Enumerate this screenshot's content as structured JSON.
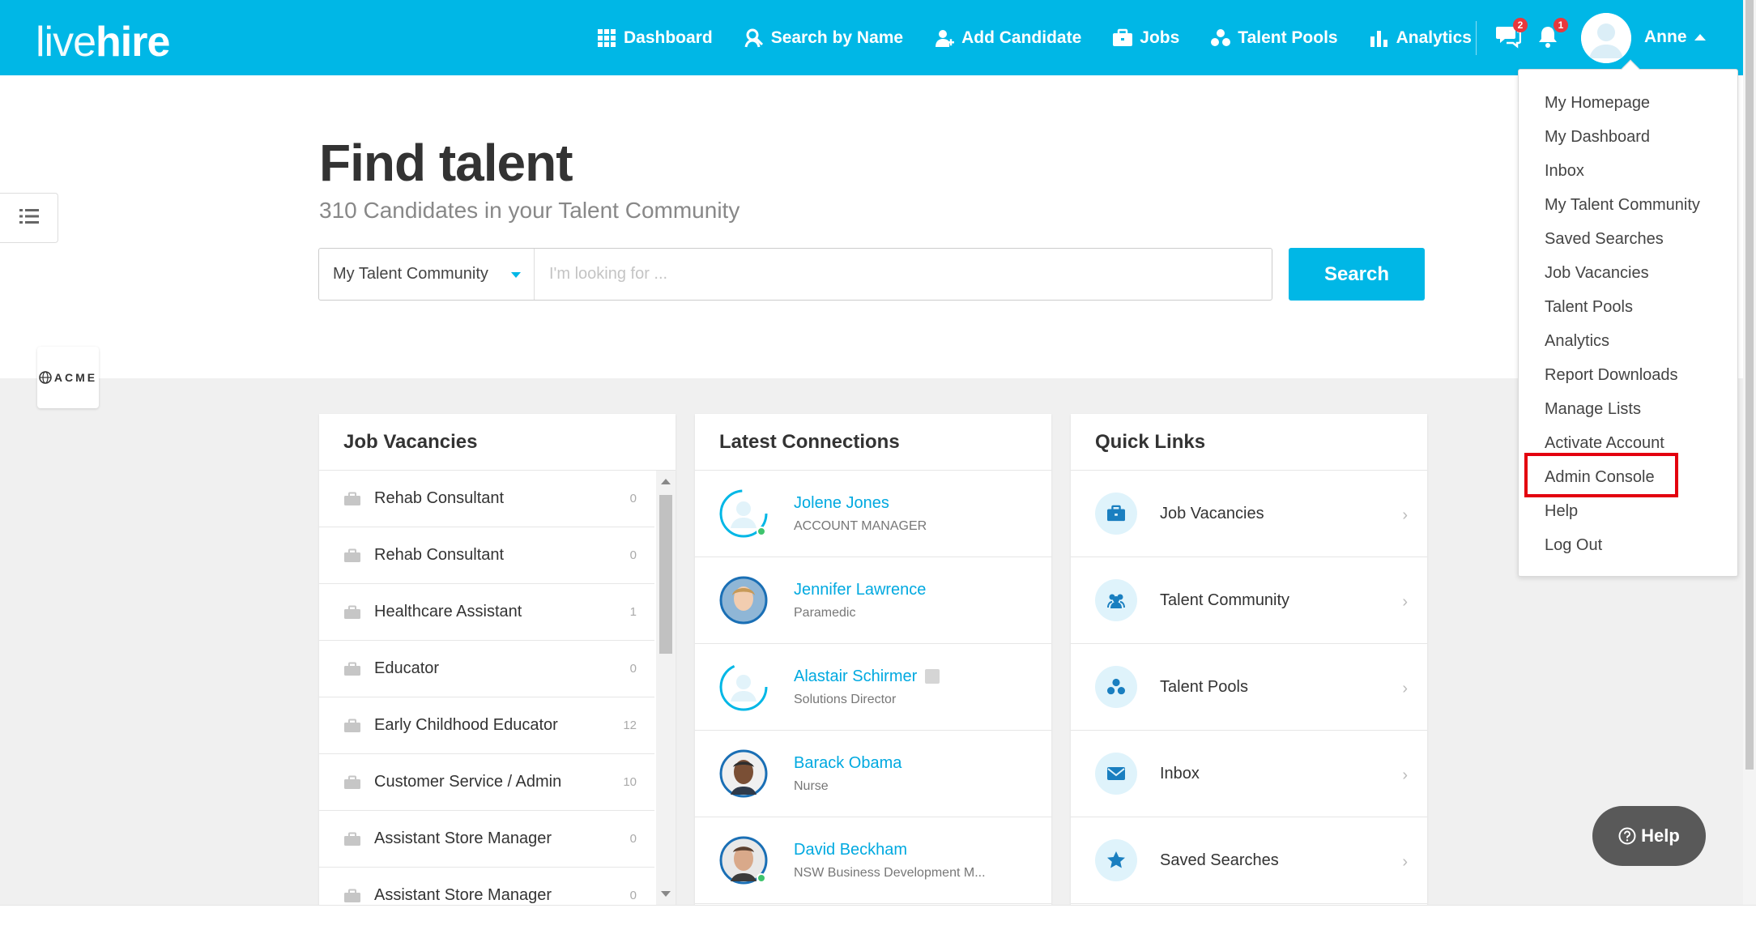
{
  "app": {
    "logo_light": "live",
    "logo_bold": "hire",
    "brand_color": "#00b7e6"
  },
  "nav": {
    "items": [
      {
        "label": "Dashboard",
        "icon": "grid-icon"
      },
      {
        "label": "Search by Name",
        "icon": "person-search-icon"
      },
      {
        "label": "Add Candidate",
        "icon": "add-person-icon"
      },
      {
        "label": "Jobs",
        "icon": "briefcase-icon"
      },
      {
        "label": "Talent Pools",
        "icon": "pool-icon"
      },
      {
        "label": "Analytics",
        "icon": "bar-chart-icon"
      }
    ],
    "messages_badge": "2",
    "alerts_badge": "1",
    "user_name": "Anne"
  },
  "hero": {
    "title": "Find talent",
    "subtitle": "310 Candidates in your Talent Community",
    "scope": "My Talent Community",
    "placeholder": "I'm looking for ...",
    "search_label": "Search"
  },
  "company_logo_text": "ACME",
  "job_vacancies": {
    "title": "Job Vacancies",
    "items": [
      {
        "title": "Rehab Consultant",
        "count": "0"
      },
      {
        "title": "Rehab Consultant",
        "count": "0"
      },
      {
        "title": "Healthcare Assistant",
        "count": "1"
      },
      {
        "title": "Educator",
        "count": "0"
      },
      {
        "title": "Early Childhood Educator",
        "count": "12"
      },
      {
        "title": "Customer Service / Admin",
        "count": "10"
      },
      {
        "title": "Assistant Store Manager",
        "count": "0"
      },
      {
        "title": "Assistant Store Manager",
        "count": "0"
      }
    ]
  },
  "latest_connections": {
    "title": "Latest Connections",
    "items": [
      {
        "name": "Jolene Jones",
        "role": "ACCOUNT MANAGER"
      },
      {
        "name": "Jennifer Lawrence",
        "role": "Paramedic"
      },
      {
        "name": "Alastair Schirmer",
        "role": "Solutions Director"
      },
      {
        "name": "Barack Obama",
        "role": "Nurse"
      },
      {
        "name": "David Beckham",
        "role": "NSW Business Development M..."
      }
    ]
  },
  "quick_links": {
    "title": "Quick Links",
    "items": [
      {
        "label": "Job Vacancies",
        "icon": "briefcase-icon"
      },
      {
        "label": "Talent Community",
        "icon": "community-icon"
      },
      {
        "label": "Talent Pools",
        "icon": "pool-icon"
      },
      {
        "label": "Inbox",
        "icon": "envelope-icon"
      },
      {
        "label": "Saved Searches",
        "icon": "star-icon"
      }
    ]
  },
  "user_menu": {
    "items": [
      "My Homepage",
      "My Dashboard",
      "Inbox",
      "My Talent Community",
      "Saved Searches",
      "Job Vacancies",
      "Talent Pools",
      "Analytics",
      "Report Downloads",
      "Manage Lists",
      "Activate Account",
      "Admin Console",
      "Help",
      "Log Out"
    ],
    "highlighted": "Admin Console",
    "highlight_color": "#e3000f"
  },
  "help_button": "Help"
}
